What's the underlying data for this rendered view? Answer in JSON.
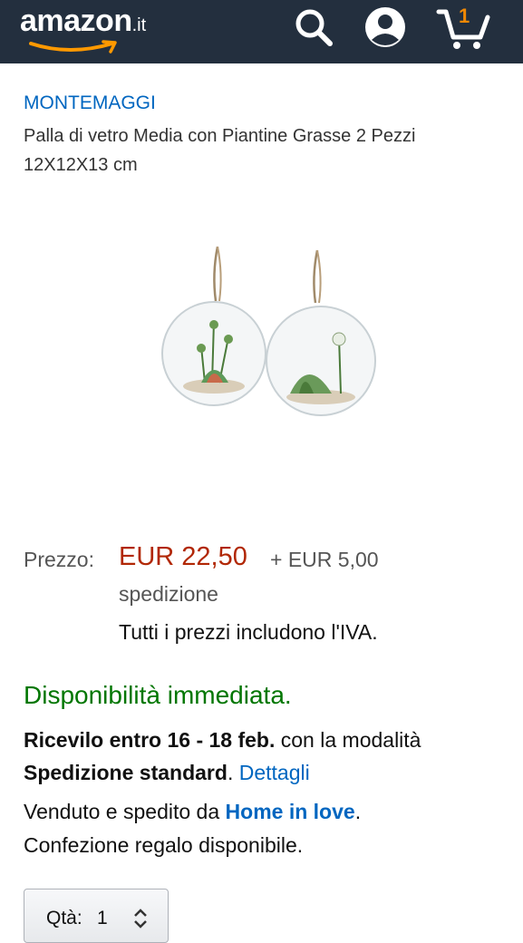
{
  "header": {
    "logo_text": "amazon",
    "logo_tld": ".it",
    "cart_count": "1",
    "icons": [
      "search-icon",
      "account-icon",
      "cart-icon"
    ],
    "colors": {
      "background": "#232f3e",
      "accent": "#ff9900"
    }
  },
  "product": {
    "brand": "MONTEMAGGI",
    "title": "Palla di vetro Media con Piantine Grasse 2 Pezzi 12X12X13 cm"
  },
  "pricing": {
    "label": "Prezzo:",
    "price": "EUR 22,50",
    "shipping": "+ EUR 5,00",
    "shipping_word": "spedizione",
    "vat_note": "Tutti i prezzi includono l'IVA."
  },
  "availability": {
    "text": "Disponibilità immediata.",
    "color": "#007600"
  },
  "delivery": {
    "bold_1": "Ricevilo entro 16 - 18 feb.",
    "text_1": " con la modalità",
    "bold_2": "Spedizione standard",
    "text_2": ". ",
    "link": "Dettagli"
  },
  "seller": {
    "prefix": "Venduto e spedito da ",
    "name": "Home in love",
    "suffix": ".",
    "gift": "Confezione regalo disponibile."
  },
  "quantity": {
    "label": "Qtà:",
    "value": "1"
  }
}
